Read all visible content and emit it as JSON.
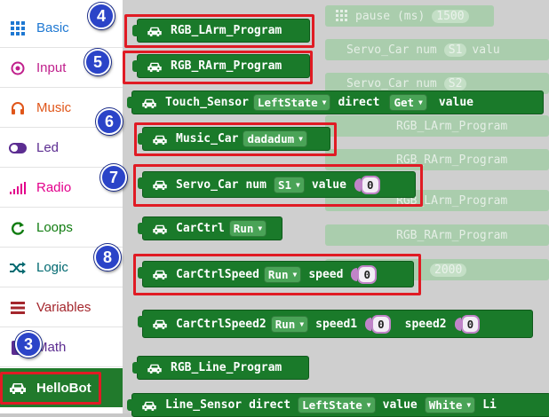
{
  "sidebar": {
    "categories": [
      {
        "label": "Basic",
        "icon": "grid-icon",
        "color": "#1e78d2"
      },
      {
        "label": "Input",
        "icon": "target-icon",
        "color": "#c01f8c"
      },
      {
        "label": "Music",
        "icon": "headphones-icon",
        "color": "#e0561a"
      },
      {
        "label": "Led",
        "icon": "toggle-icon",
        "color": "#5c2d91"
      },
      {
        "label": "Radio",
        "icon": "signal-bars-icon",
        "color": "#e3008c"
      },
      {
        "label": "Loops",
        "icon": "refresh-icon",
        "color": "#107c10"
      },
      {
        "label": "Logic",
        "icon": "shuffle-icon",
        "color": "#006970"
      },
      {
        "label": "Variables",
        "icon": "list-lines-icon",
        "color": "#a4262c"
      },
      {
        "label": "Math",
        "icon": "calculator-icon",
        "color": "#5c2d91"
      },
      {
        "label": "HelloBot",
        "icon": "car-icon",
        "color": "#ffffff"
      }
    ]
  },
  "faint_blocks": {
    "pause_label": "pause (ms)",
    "pause_value": "1500",
    "servo_a": "Servo_Car num",
    "servo_a_dd": "S1",
    "servo_a_tail": "valu",
    "servo_b": "Servo_Car num",
    "servo_b_dd": "S2",
    "larm": "RGB_LArm_Program",
    "rarm_top": "RGB_RArm_Program",
    "larm2": "RGB_LArm_Program",
    "rarm2": "RGB_RArm_Program",
    "pause2_value": "2000"
  },
  "blocks": {
    "larm": "RGB_LArm_Program",
    "rarm": "RGB_RArm_Program",
    "touch_sensor": "Touch_Sensor",
    "touch_dd1": "LeftState",
    "touch_direct": "direct",
    "touch_dd2": "Get",
    "touch_value": "value",
    "music_car": "Music_Car",
    "music_dd": "dadadum",
    "servo_car": "Servo_Car",
    "servo_num": "num",
    "servo_dd": "S1",
    "servo_value_label": "value",
    "servo_value": "0",
    "carctrl": "CarCtrl",
    "carctrl_dd": "Run",
    "carctrlspeed": "CarCtrlSpeed",
    "carctrlspeed_dd": "Run",
    "carctrlspeed_speed": "speed",
    "carctrlspeed_value": "0",
    "carctrlspeed2": "CarCtrlSpeed2",
    "carctrlspeed2_dd": "Run",
    "speed1_label": "speed1",
    "speed1_value": "0",
    "speed2_label": "speed2",
    "speed2_value": "0",
    "line_program": "RGB_Line_Program",
    "line_sensor": "Line_Sensor",
    "line_direct": "direct",
    "line_dd1": "LeftState",
    "line_value": "value",
    "line_dd2": "White",
    "line_tail": "Li"
  },
  "badges": [
    "3",
    "4",
    "5",
    "6",
    "7",
    "8"
  ],
  "highlight_color": "#e01b24",
  "badge_color": "#2b44c8"
}
